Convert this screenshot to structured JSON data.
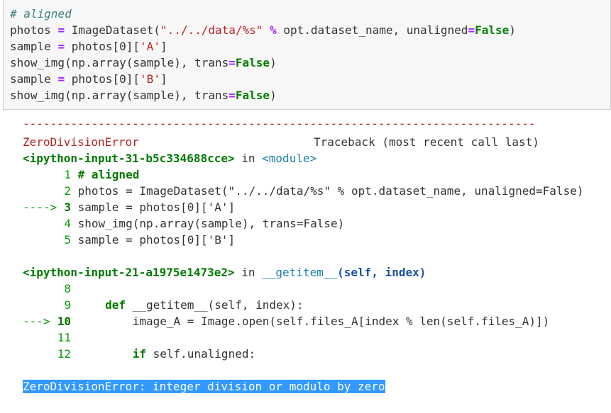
{
  "input_cell": {
    "lines": [
      {
        "parts": [
          {
            "t": "# aligned",
            "c": "cm"
          }
        ]
      },
      {
        "parts": [
          {
            "t": "photos ",
            "c": ""
          },
          {
            "t": "=",
            "c": "op"
          },
          {
            "t": " ImageDataset(",
            "c": ""
          },
          {
            "t": "\"../../data/%s\"",
            "c": "str"
          },
          {
            "t": " ",
            "c": ""
          },
          {
            "t": "%",
            "c": "op"
          },
          {
            "t": " opt.dataset_name, unaligned",
            "c": ""
          },
          {
            "t": "=",
            "c": "op"
          },
          {
            "t": "False",
            "c": "kw"
          },
          {
            "t": ")",
            "c": ""
          }
        ]
      },
      {
        "parts": [
          {
            "t": "sample ",
            "c": ""
          },
          {
            "t": "=",
            "c": "op"
          },
          {
            "t": " photos[0][",
            "c": ""
          },
          {
            "t": "'A'",
            "c": "str"
          },
          {
            "t": "]",
            "c": ""
          }
        ]
      },
      {
        "parts": [
          {
            "t": "show_img(np.array(sample), trans",
            "c": ""
          },
          {
            "t": "=",
            "c": "op"
          },
          {
            "t": "False",
            "c": "kw"
          },
          {
            "t": ")",
            "c": ""
          }
        ]
      },
      {
        "parts": [
          {
            "t": "sample ",
            "c": ""
          },
          {
            "t": "=",
            "c": "op"
          },
          {
            "t": " photos[0][",
            "c": ""
          },
          {
            "t": "'B'",
            "c": "str"
          },
          {
            "t": "]",
            "c": ""
          }
        ]
      },
      {
        "parts": [
          {
            "t": "show_img(np.array(sample), trans",
            "c": ""
          },
          {
            "t": "=",
            "c": "op"
          },
          {
            "t": "False",
            "c": "kw"
          },
          {
            "t": ")",
            "c": ""
          }
        ]
      }
    ]
  },
  "traceback": {
    "dashes": "---------------------------------------------------------------------------",
    "error_name": "ZeroDivisionError",
    "traceback_header": "Traceback (most recent call last)",
    "frames": [
      {
        "location": "<ipython-input-31-b5c334688cce>",
        "in": " in ",
        "func": "<module>",
        "lines": [
          {
            "arrow": "",
            "num": "1",
            "code_parts": [
              {
                "t": " # aligned",
                "c": "tb-bgreen"
              }
            ]
          },
          {
            "arrow": "",
            "num": "2",
            "code_parts": [
              {
                "t": " photos = ImageDataset(\"../../data/%s\" % opt.dataset_name, unaligned=False)",
                "c": ""
              }
            ]
          },
          {
            "arrow": "---->",
            "num": "3",
            "code_parts": [
              {
                "t": " sample = photos[0]['A']",
                "c": ""
              }
            ]
          },
          {
            "arrow": "",
            "num": "4",
            "code_parts": [
              {
                "t": " show_img(np.array(sample), trans=False)",
                "c": ""
              }
            ]
          },
          {
            "arrow": "",
            "num": "5",
            "code_parts": [
              {
                "t": " sample = photos[0]['B']",
                "c": ""
              }
            ]
          }
        ]
      },
      {
        "location": "<ipython-input-21-a1975e1473e2>",
        "in": " in ",
        "func": "__getitem__",
        "sig": "(self, index)",
        "lines": [
          {
            "arrow": "",
            "num": "8",
            "code_parts": []
          },
          {
            "arrow": "",
            "num": "9",
            "code_parts": [
              {
                "t": "     def",
                "c": "tb-bgreen"
              },
              {
                "t": " __getitem__(self, index):",
                "c": ""
              }
            ]
          },
          {
            "arrow": "--->",
            "num": "10",
            "code_parts": [
              {
                "t": "         image_A = Image.open(self.files_A[index % len(self.files_A)])",
                "c": ""
              }
            ]
          },
          {
            "arrow": "",
            "num": "11",
            "code_parts": []
          },
          {
            "arrow": "",
            "num": "12",
            "code_parts": [
              {
                "t": "         if",
                "c": "tb-bgreen"
              },
              {
                "t": " self.unaligned:",
                "c": ""
              }
            ]
          }
        ]
      }
    ],
    "final_error_name": "ZeroDivisionError",
    "final_error_msg": ": integer division or modulo by zero"
  }
}
